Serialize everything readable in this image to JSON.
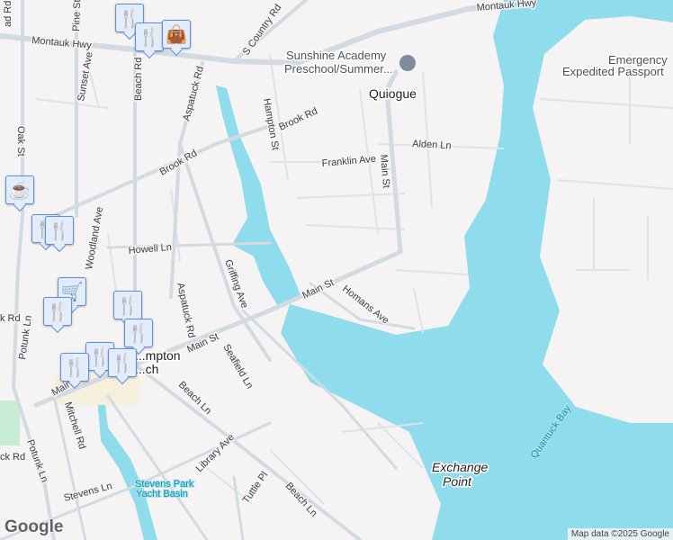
{
  "colors": {
    "water": "#8fdcec",
    "land": "#f5f3f3",
    "road": "#d3dbe2",
    "marker": "#0f4a6e",
    "park": "#c8ecd4"
  },
  "roads": [
    "Montauk Hwy",
    "Montauk Hwy",
    "S Country Rd",
    "Brook Rd",
    "Brook Rd",
    "Hampton St",
    "Aspatuck Rd",
    "Aspatuck Rd",
    "Beach Rd",
    "Sunset Ave",
    "Pine St",
    "Oak St",
    "Woodland Ave",
    "Howell Ln",
    "Griffing Ave",
    "Main St",
    "Main St",
    "Main St",
    "Main St",
    "Franklin Ave",
    "Alden Ln",
    "Homans Ave",
    "Seafield Ln",
    "Beach Ln",
    "Beach Ln",
    "Library Ave",
    "Tuttle Pl",
    "Stevens Ln",
    "Mitchell Rd",
    "Potunk Ln",
    "Potunk Ln",
    "Old Meetinghouse Rd",
    "Sunset Ave"
  ],
  "road_labels": {
    "montauk_w": "Montauk Hwy",
    "montauk_e": "Montauk Hwy",
    "s_country": "S Country Rd",
    "brook_1": "Brook Rd",
    "brook_2": "Brook Rd",
    "hampton": "Hampton St",
    "aspatuck_1": "Aspatuck Rd",
    "aspatuck_2": "Aspatuck Rd",
    "beach_rd": "Beach Rd",
    "sunset": "Sunset Ave",
    "pine": "Pine St",
    "oak": "Oak St",
    "woodland": "Woodland Ave",
    "howell": "Howell Ln",
    "griffing": "Griffing Ave",
    "main_1": "Main St",
    "main_2": "Main St",
    "main_3": "Main St",
    "franklin": "Franklin Ave",
    "alden": "Alden Ln",
    "homans": "Homans Ave",
    "seafield": "Seafield Ln",
    "beach_ln_1": "Beach Ln",
    "beach_ln_2": "Beach Ln",
    "library": "Library Ave",
    "tuttle": "Tuttle Pl",
    "stevens": "Stevens Ln",
    "mitchell": "Mitchell Rd",
    "potunk_1": "Potunk Ln",
    "potunk_2": "Potunk Ln",
    "rd_partial": "ad Rd",
    "rd_partial2": "ck Rd",
    "rd_partial3": "k Rd"
  },
  "places": {
    "quiogue": "Quiogue",
    "westhampton_1": "...mpton",
    "westhampton_2": "...ch",
    "exchange_1": "Exchange",
    "exchange_2": "Point"
  },
  "water_labels": {
    "quantuck": "Quantuck Bay",
    "yacht_1": "Stevens Park",
    "yacht_2": "Yacht Basin"
  },
  "pois": {
    "academy_1": "Sunshine Academy",
    "academy_2": "Preschool/Summer...",
    "passport_1": "Emergency",
    "passport_2": "Expedited Passport"
  },
  "markers": [
    {
      "icon": "restaurant"
    },
    {
      "icon": "restaurant"
    },
    {
      "icon": "shopping"
    },
    {
      "icon": "cafe"
    },
    {
      "icon": "restaurant"
    },
    {
      "icon": "restaurant"
    },
    {
      "icon": "grocery"
    },
    {
      "icon": "restaurant"
    },
    {
      "icon": "restaurant"
    },
    {
      "icon": "restaurant"
    },
    {
      "icon": "restaurant"
    },
    {
      "icon": "restaurant"
    },
    {
      "icon": "restaurant"
    }
  ],
  "attribution": {
    "logo": "Google",
    "data": "Map data ©2025 Google"
  }
}
